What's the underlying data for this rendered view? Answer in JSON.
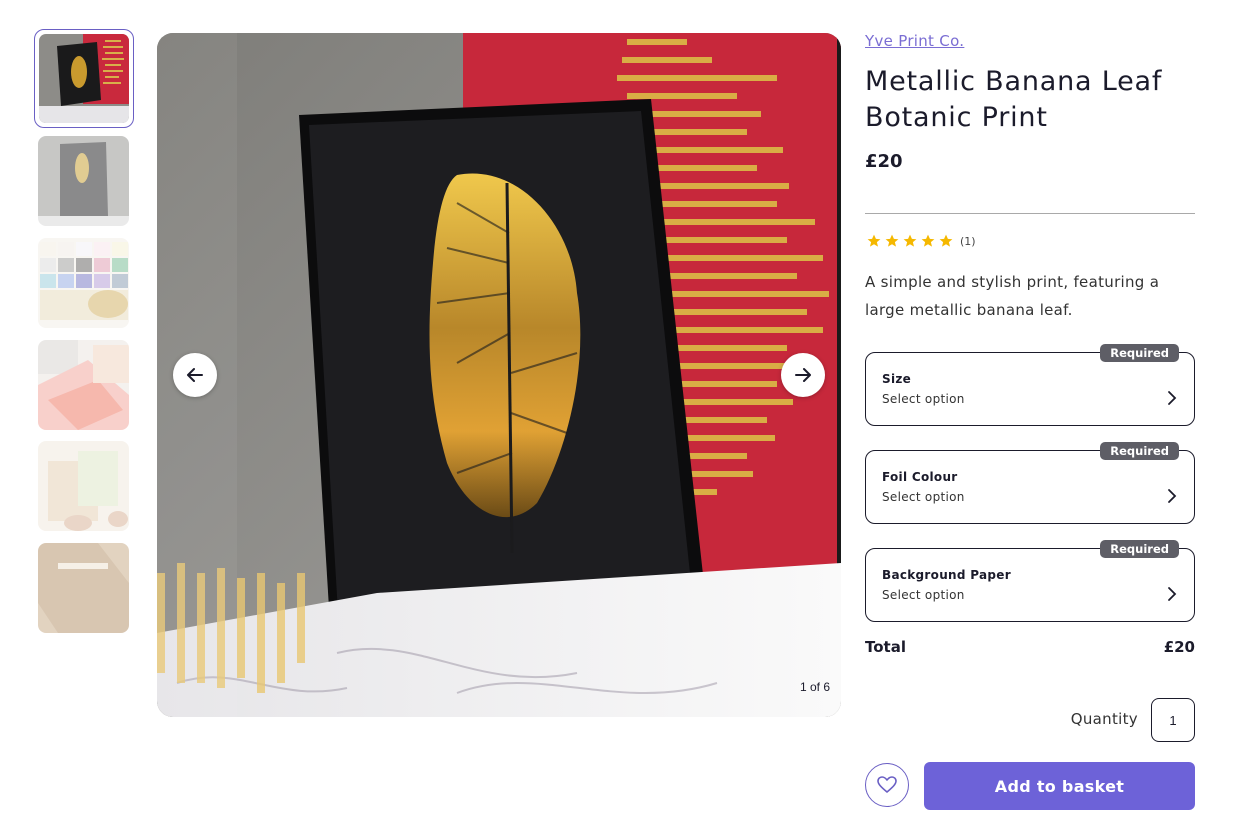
{
  "product": {
    "brand": "Yve Print Co.",
    "title": "Metallic Banana Leaf Botanic Print",
    "price": "£20",
    "rating_count": "(1)",
    "rating_value": 5,
    "description": "A simple and stylish print, featuring a large metallic banana leaf."
  },
  "gallery": {
    "counter": "1 of 6",
    "thumbnails": [
      {
        "alt": "Black frame with gold leaf print"
      },
      {
        "alt": "Framed leaf print in grey"
      },
      {
        "alt": "Paper colour swatches"
      },
      {
        "alt": "Frames and pink prints"
      },
      {
        "alt": "Hands holding print"
      },
      {
        "alt": "Packaging"
      }
    ]
  },
  "options": [
    {
      "label": "Size",
      "value": "Select option",
      "badge": "Required"
    },
    {
      "label": "Foil Colour",
      "value": "Select option",
      "badge": "Required"
    },
    {
      "label": "Background Paper",
      "value": "Select option",
      "badge": "Required"
    }
  ],
  "total": {
    "label": "Total",
    "value": "£20"
  },
  "quantity": {
    "label": "Quantity",
    "value": "1"
  },
  "actions": {
    "add_to_basket": "Add to basket"
  },
  "colors": {
    "accent": "#6d62d8",
    "brand_link": "#7a6dd3",
    "star": "#f5b800",
    "badge": "#5e5e66"
  },
  "icons": {
    "prev": "arrow-left-icon",
    "next": "arrow-right-icon",
    "favourite": "heart-icon",
    "chevron": "chevron-right-icon",
    "star": "star-icon"
  }
}
